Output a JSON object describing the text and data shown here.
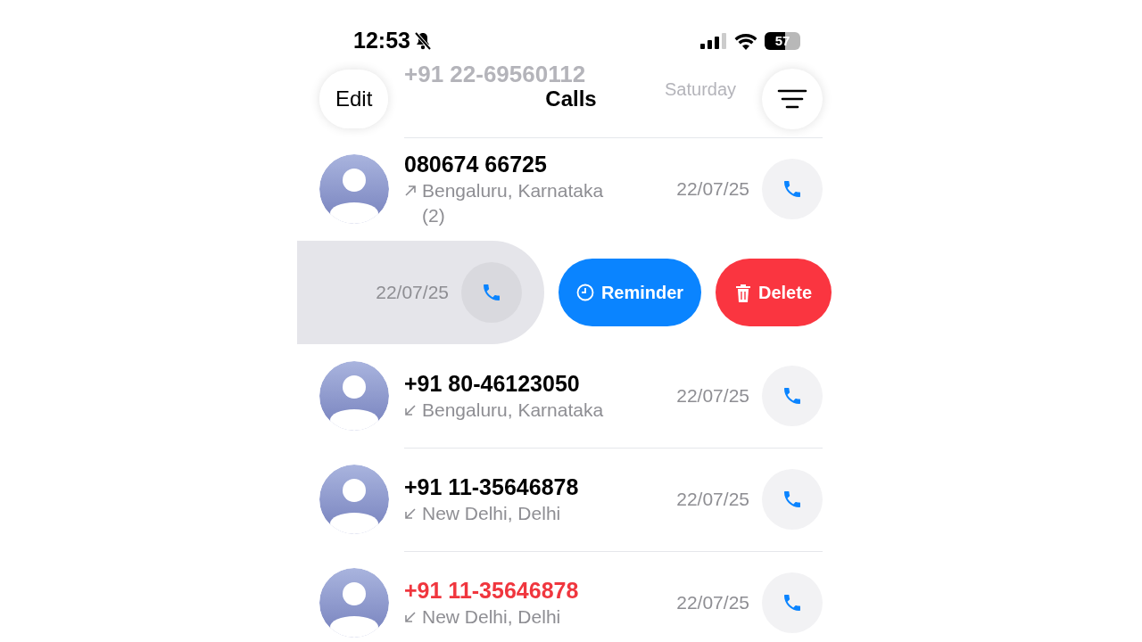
{
  "status_bar": {
    "time": "12:53",
    "silent": true,
    "battery": "57"
  },
  "background_row": {
    "number": "+91 22-69560112",
    "date": "Saturday"
  },
  "nav": {
    "edit": "Edit",
    "title": "Calls"
  },
  "calls": [
    {
      "kind": "call",
      "number": "080674 66725",
      "outgoing": true,
      "location": "Bengaluru, Karnataka (2)",
      "date": "22/07/25",
      "missed": false
    },
    {
      "kind": "swiped",
      "date": "22/07/25",
      "actions": [
        {
          "kind": "reminder",
          "label": "Reminder"
        },
        {
          "kind": "delete",
          "label": "Delete"
        }
      ]
    },
    {
      "kind": "call",
      "number": "+91 80-46123050",
      "outgoing": false,
      "location": "Bengaluru, Karnataka",
      "date": "22/07/25",
      "missed": false
    },
    {
      "kind": "call",
      "number": "+91 11-35646878",
      "outgoing": false,
      "location": "New Delhi, Delhi",
      "date": "22/07/25",
      "missed": false
    },
    {
      "kind": "call",
      "number": "+91 11-35646878",
      "outgoing": false,
      "location": "New Delhi, Delhi",
      "date": "22/07/25",
      "missed": true
    }
  ]
}
